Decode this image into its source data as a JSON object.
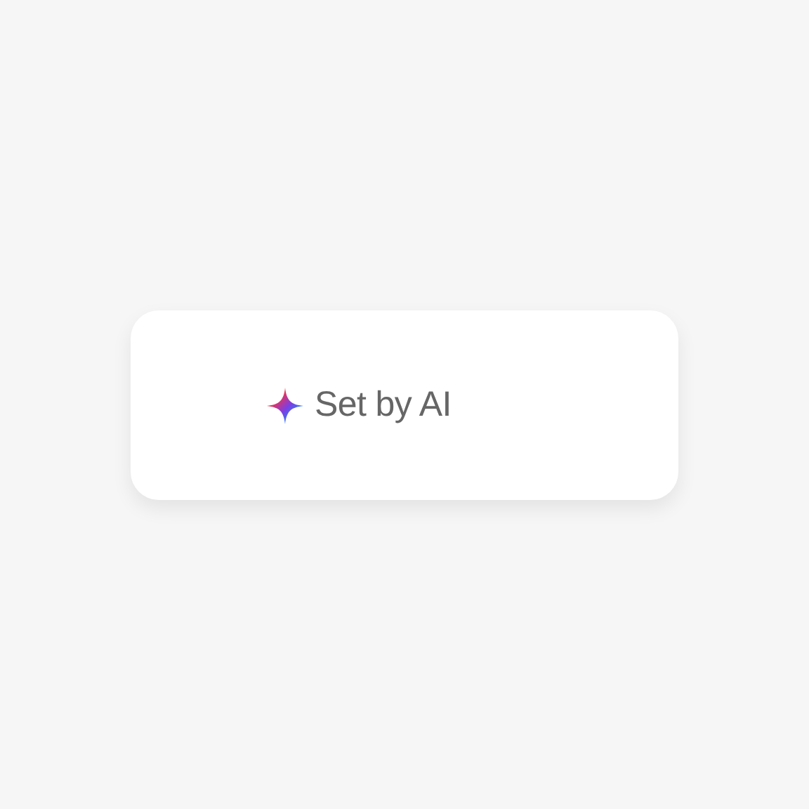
{
  "label": {
    "text": "Set by AI"
  }
}
